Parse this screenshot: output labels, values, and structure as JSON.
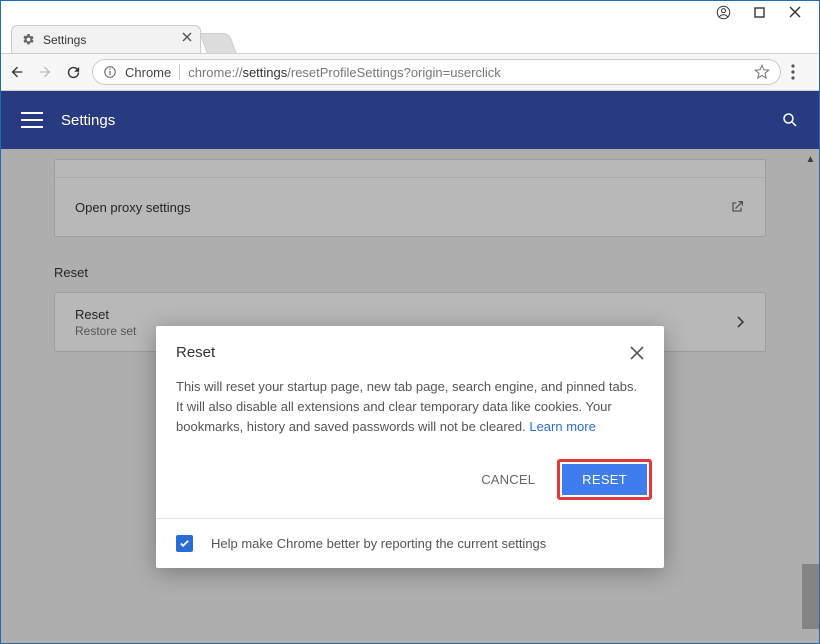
{
  "window": {
    "tab_title": "Settings"
  },
  "omnibox": {
    "origin_label": "Chrome",
    "url_prefix": "chrome://",
    "url_bold": "settings",
    "url_rest": "/resetProfileSettings?origin=userclick"
  },
  "header": {
    "title": "Settings"
  },
  "page": {
    "proxy_row": "Open proxy settings",
    "section_reset": "Reset",
    "reset_row_title": "Reset",
    "reset_row_sub": "Restore set"
  },
  "dialog": {
    "title": "Reset",
    "body_text": "This will reset your startup page, new tab page, search engine, and pinned tabs. It will also disable all extensions and clear temporary data like cookies. Your bookmarks, history and saved passwords will not be cleared. ",
    "learn_more": "Learn more",
    "cancel": "CANCEL",
    "reset": "RESET",
    "footer_text": "Help make Chrome better by reporting the ",
    "footer_link": "current settings"
  }
}
